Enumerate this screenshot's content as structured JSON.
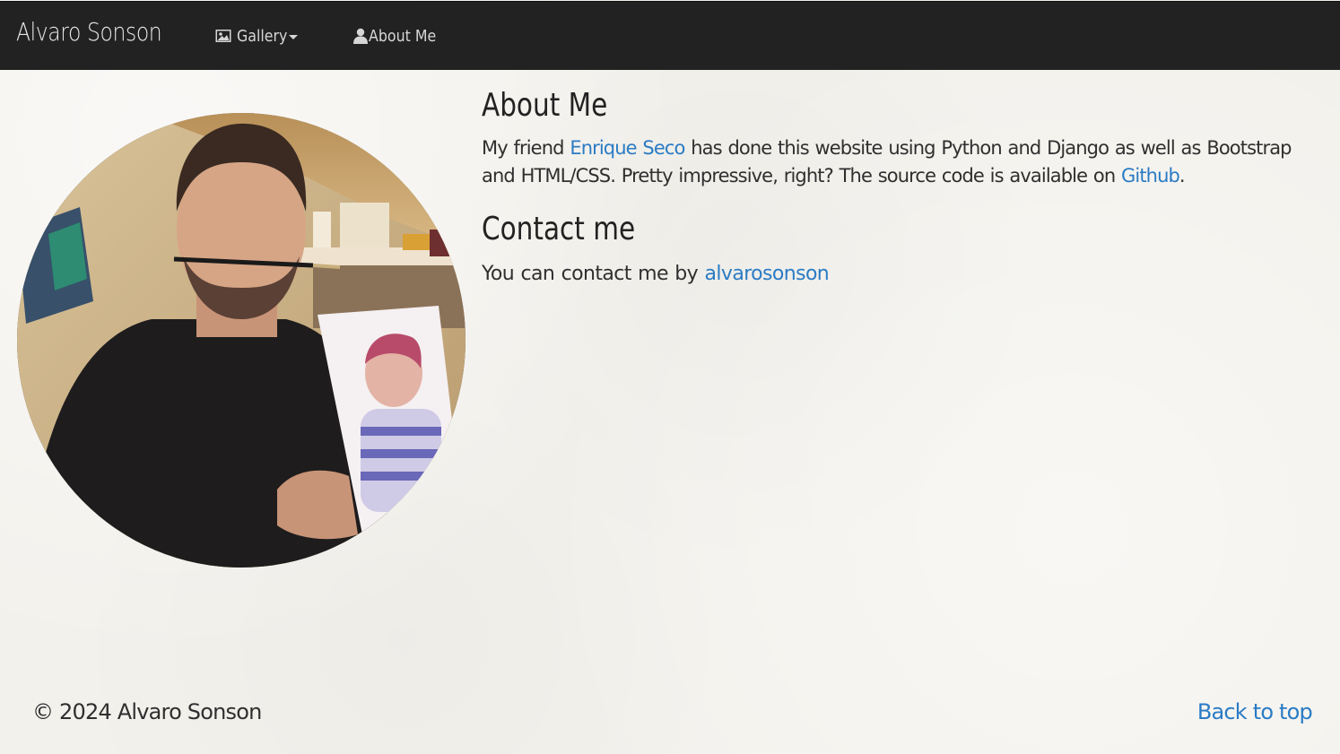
{
  "navbar": {
    "brand": "Alvaro Sonson",
    "items": [
      {
        "label": "Gallery",
        "icon": "picture-icon",
        "has_dropdown": true
      },
      {
        "label": "About Me",
        "icon": "user-icon",
        "has_dropdown": false
      }
    ],
    "background_color": "#222222"
  },
  "profile": {
    "image_alt": "Portrait photo of a man holding a watercolor painting"
  },
  "about": {
    "heading": "About Me",
    "text_before_link1": "My friend ",
    "link1": "Enrique Seco",
    "text_between": " has done this website using Python and Django as well as Bootstrap and HTML/CSS. Pretty impressive, right? The source code is available on ",
    "link2": "Github",
    "text_after": "."
  },
  "contact": {
    "heading": "Contact me",
    "text": "You can contact me by ",
    "link": "alvarosonson"
  },
  "footer": {
    "copyright": "© 2024 Alvaro Sonson",
    "back_to_top": "Back to top"
  },
  "colors": {
    "link": "#2a7bc4",
    "page_background": "#f3f1ec",
    "text": "#2f2f2f"
  }
}
